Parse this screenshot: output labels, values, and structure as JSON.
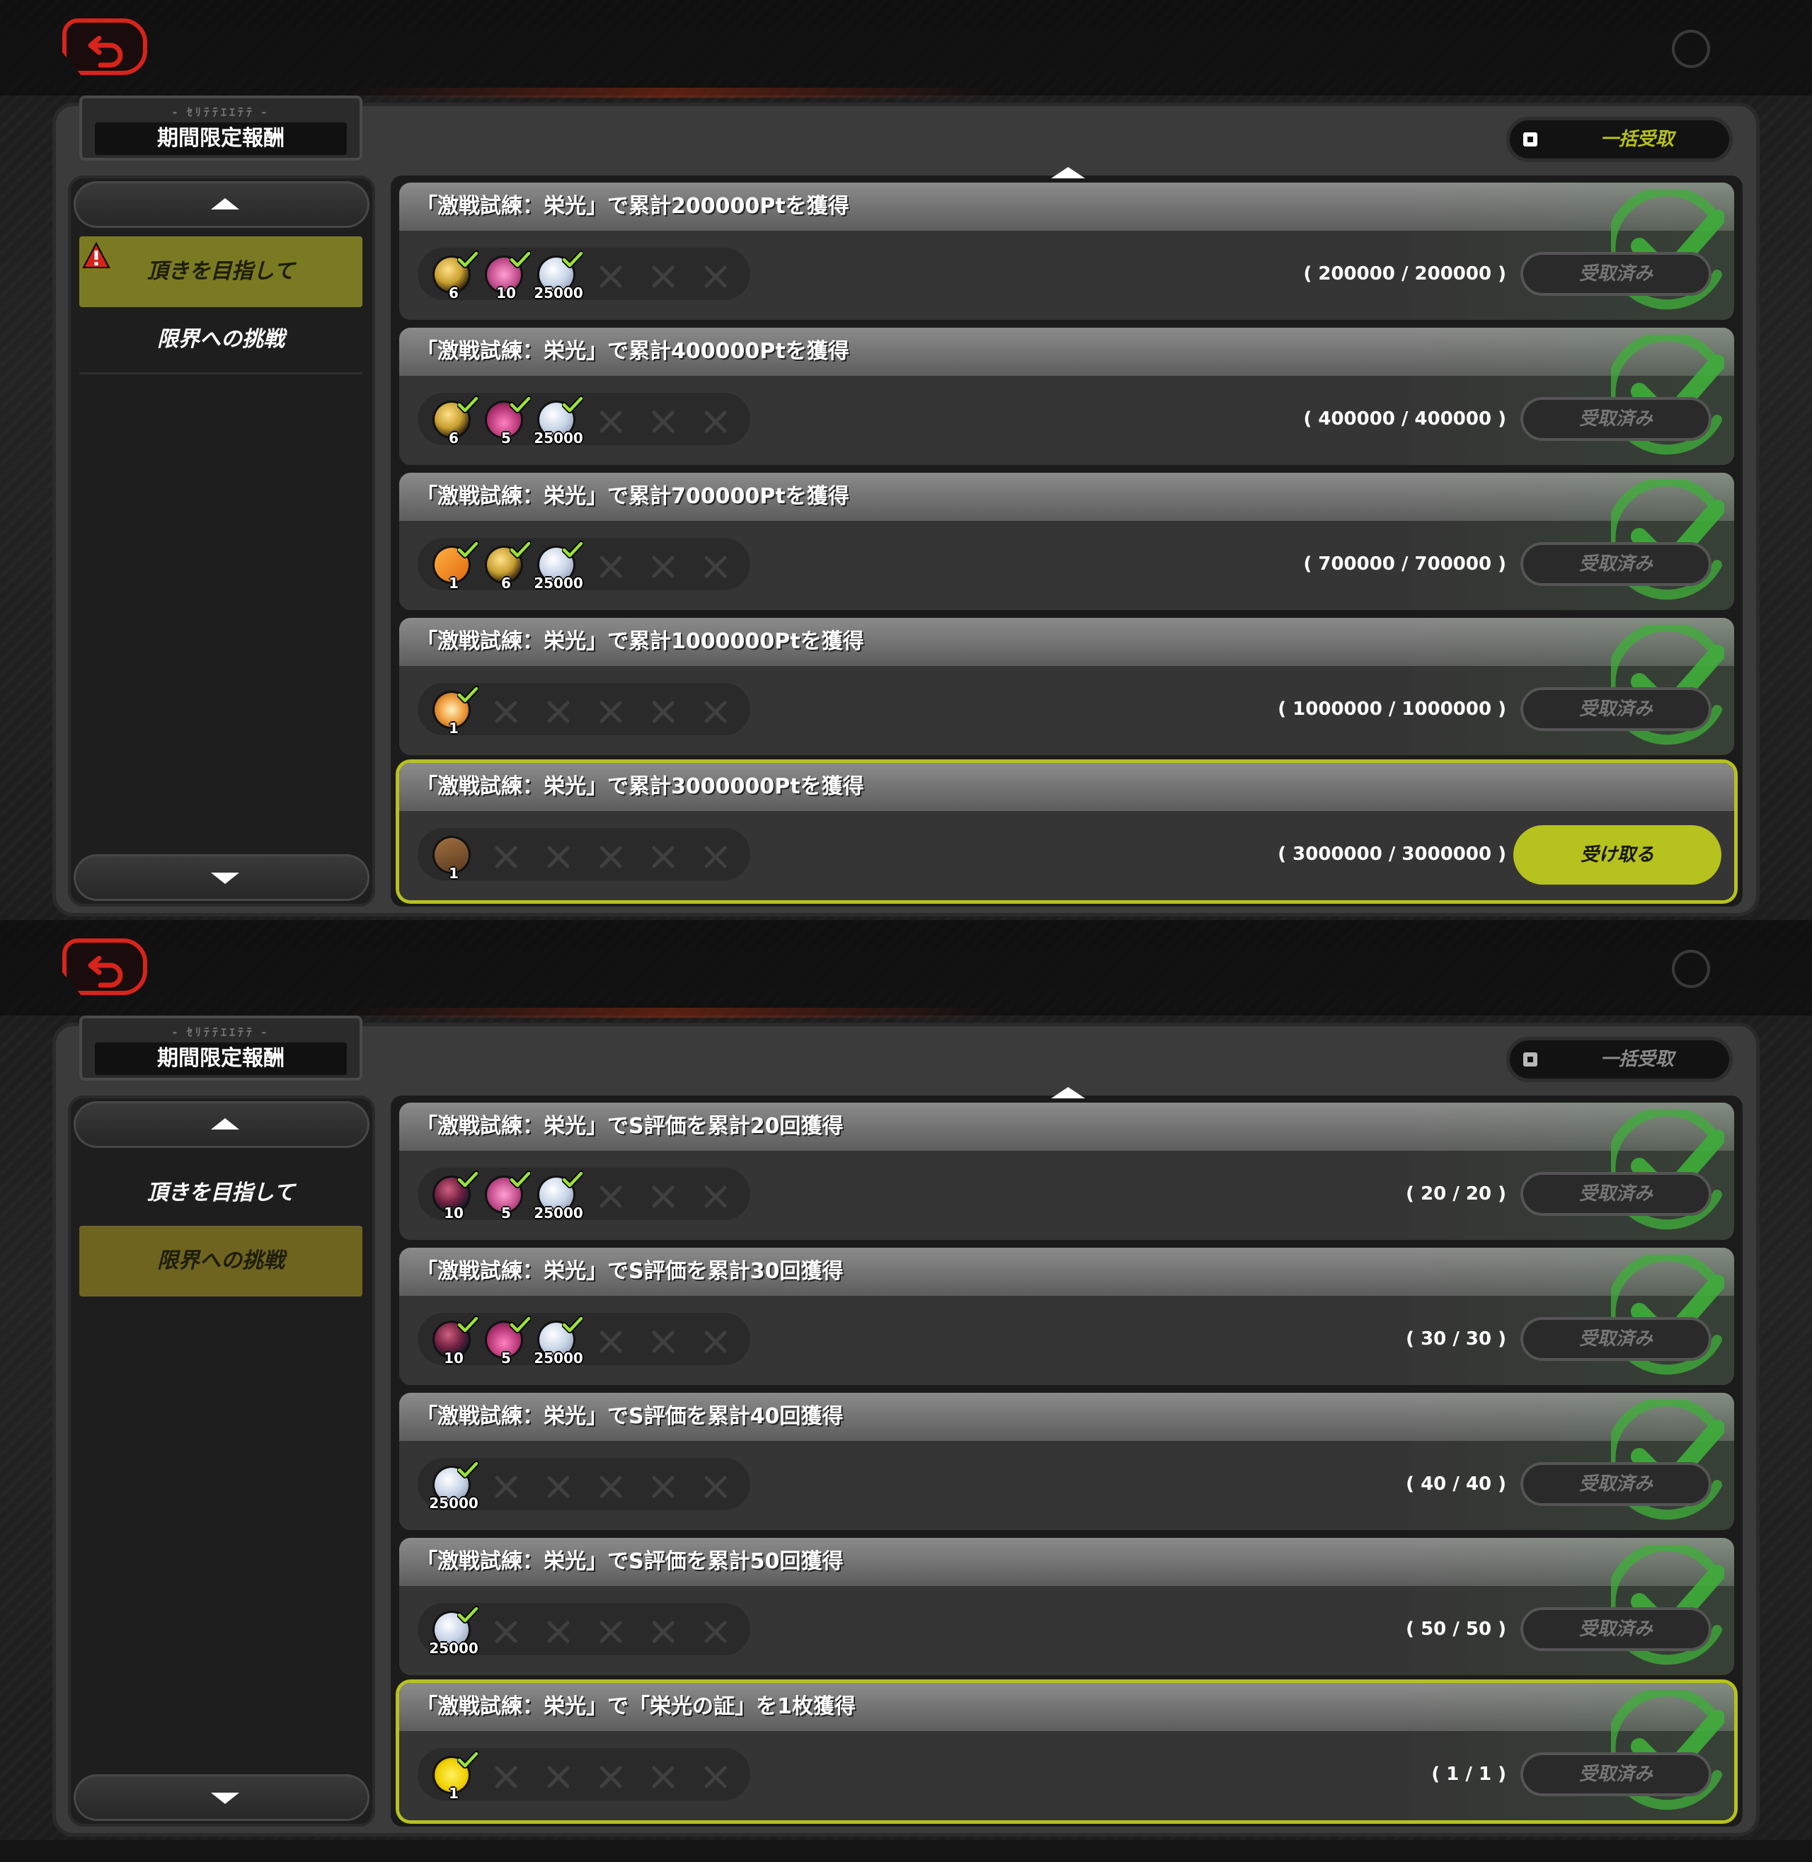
{
  "colors": {
    "accent_lime": "#b6c21d",
    "active_tab_olive": "#7a7a22",
    "back_red": "#d7241b",
    "check_green": "#3fae3a"
  },
  "screens": [
    {
      "title_sub": "- ｾﾘﾃﾃｴｴﾃﾃ -",
      "title": "期間限定報酬",
      "bulk_label": "一括受取",
      "bulk_enabled": true,
      "categories": [
        {
          "label": "頂きを目指して",
          "active": true,
          "alert": true
        },
        {
          "label": "限界への挑戦",
          "active": false,
          "alert": false
        }
      ],
      "missions": [
        {
          "text": "「激戦試練：栄光」で累計200000Ptを獲得",
          "progress": "( 200000 / 200000 )",
          "rewards": [
            {
              "icon": "gold-sphere-icon",
              "count": "6"
            },
            {
              "icon": "pink-car-icon",
              "count": "10"
            },
            {
              "icon": "silver-coin-icon",
              "count": "25000"
            }
          ],
          "claim_label": "受取済み",
          "claim_state": "done",
          "completed": true,
          "highlight": false
        },
        {
          "text": "「激戦試練：栄光」で累計400000Ptを獲得",
          "progress": "( 400000 / 400000 )",
          "rewards": [
            {
              "icon": "gold-sphere-icon",
              "count": "6"
            },
            {
              "icon": "pink-flask-icon",
              "count": "5"
            },
            {
              "icon": "silver-coin-icon",
              "count": "25000"
            }
          ],
          "claim_label": "受取済み",
          "claim_state": "done",
          "completed": true,
          "highlight": false
        },
        {
          "text": "「激戦試練：栄光」で累計700000Ptを獲得",
          "progress": "( 700000 / 700000 )",
          "rewards": [
            {
              "icon": "orange-ticket-icon",
              "count": "1"
            },
            {
              "icon": "gold-sphere-icon",
              "count": "6"
            },
            {
              "icon": "silver-coin-icon",
              "count": "25000"
            }
          ],
          "claim_label": "受取済み",
          "claim_state": "done",
          "completed": true,
          "highlight": false
        },
        {
          "text": "「激戦試練：栄光」で累計1000000Ptを獲得",
          "progress": "( 1000000 / 1000000 )",
          "rewards": [
            {
              "icon": "orange-emblem-icon",
              "count": "1"
            }
          ],
          "claim_label": "受取済み",
          "claim_state": "done",
          "completed": true,
          "highlight": false
        },
        {
          "text": "「激戦試練：栄光」で累計3000000Ptを獲得",
          "progress": "( 3000000 / 3000000 )",
          "rewards": [
            {
              "icon": "brown-chest-icon",
              "count": "1"
            }
          ],
          "claim_label": "受け取る",
          "claim_state": "ready",
          "completed": false,
          "highlight": true
        }
      ]
    },
    {
      "title_sub": "- ｾﾘﾃﾃｴｴﾃﾃ -",
      "title": "期間限定報酬",
      "bulk_label": "一括受取",
      "bulk_enabled": false,
      "categories": [
        {
          "label": "頂きを目指して",
          "active": false,
          "alert": false
        },
        {
          "label": "限界への挑戦",
          "active": true,
          "alert": false
        }
      ],
      "missions": [
        {
          "text": "「激戦試練：栄光」でS評価を累計20回獲得",
          "progress": "( 20 / 20 )",
          "rewards": [
            {
              "icon": "dark-sphere-icon",
              "count": "10"
            },
            {
              "icon": "pink-car-icon",
              "count": "5"
            },
            {
              "icon": "silver-coin-icon",
              "count": "25000"
            }
          ],
          "claim_label": "受取済み",
          "claim_state": "done",
          "completed": true,
          "highlight": false
        },
        {
          "text": "「激戦試練：栄光」でS評価を累計30回獲得",
          "progress": "( 30 / 30 )",
          "rewards": [
            {
              "icon": "dark-sphere-icon",
              "count": "10"
            },
            {
              "icon": "pink-flask-icon",
              "count": "5"
            },
            {
              "icon": "silver-coin-icon",
              "count": "25000"
            }
          ],
          "claim_label": "受取済み",
          "claim_state": "done",
          "completed": true,
          "highlight": false
        },
        {
          "text": "「激戦試練：栄光」でS評価を累計40回獲得",
          "progress": "( 40 / 40 )",
          "rewards": [
            {
              "icon": "silver-coin-icon",
              "count": "25000"
            }
          ],
          "claim_label": "受取済み",
          "claim_state": "done",
          "completed": true,
          "highlight": false
        },
        {
          "text": "「激戦試練：栄光」でS評価を累計50回獲得",
          "progress": "( 50 / 50 )",
          "rewards": [
            {
              "icon": "silver-coin-icon",
              "count": "25000"
            }
          ],
          "claim_label": "受取済み",
          "claim_state": "done",
          "completed": true,
          "highlight": false
        },
        {
          "text": "「激戦試練：栄光」で「栄光の証」を1枚獲得",
          "progress": "( 1 / 1 )",
          "rewards": [
            {
              "icon": "gold-title-icon",
              "count": "1"
            }
          ],
          "claim_label": "受取済み",
          "claim_state": "done",
          "completed": true,
          "highlight": true
        }
      ]
    }
  ]
}
